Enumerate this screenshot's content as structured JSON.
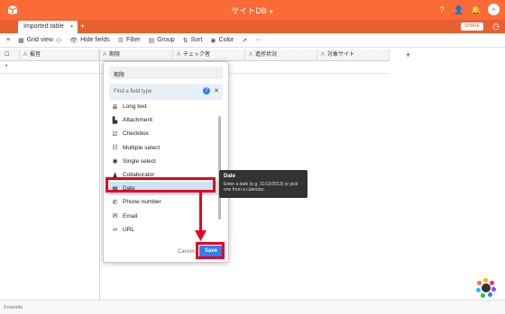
{
  "header": {
    "base_title": "サイトDB"
  },
  "tabs": [
    {
      "label": "Imported table"
    }
  ],
  "share_label": "SHARE",
  "toolbar": {
    "grid_view": "Grid view",
    "hide_fields": "Hide fields",
    "filter": "Filter",
    "group": "Group",
    "sort": "Sort",
    "color": "Color",
    "more": "···"
  },
  "columns": [
    "擬音",
    "期限",
    "チェック者",
    "進捗状況",
    "対象サイト"
  ],
  "footer": {
    "records": "0 records"
  },
  "field_pane": {
    "field_name": "期限",
    "find_placeholder": "Find a field type",
    "types": [
      {
        "label": "Long text",
        "icon": "long-text-icon"
      },
      {
        "label": "Attachment",
        "icon": "attachment-icon"
      },
      {
        "label": "Checkbox",
        "icon": "checkbox-icon"
      },
      {
        "label": "Multiple select",
        "icon": "multiple-select-icon"
      },
      {
        "label": "Single select",
        "icon": "single-select-icon"
      },
      {
        "label": "Collaborator",
        "icon": "collaborator-icon"
      },
      {
        "label": "Date",
        "icon": "date-icon",
        "selected": true
      },
      {
        "label": "Phone number",
        "icon": "phone-icon"
      },
      {
        "label": "Email",
        "icon": "email-icon"
      },
      {
        "label": "URL",
        "icon": "url-icon"
      }
    ],
    "cancel_label": "Cancel",
    "save_label": "Save"
  },
  "tooltip": {
    "title": "Date",
    "description": "Enter a date (e.g. 11/12/2013) or pick one from a calendar."
  },
  "colors": {
    "brand": "#fc6a35",
    "tabbar": "#e85f30",
    "accent": "#2d7ff9",
    "annotation": "#e8001f"
  }
}
